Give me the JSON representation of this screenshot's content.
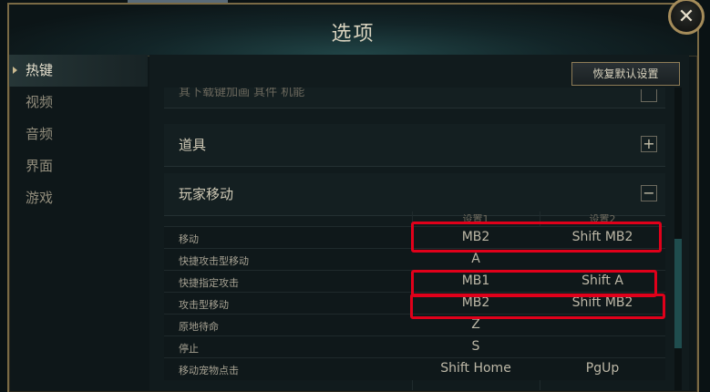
{
  "window": {
    "title": "选项",
    "close_glyph": "✕"
  },
  "sidebar": {
    "items": [
      {
        "label": "热键",
        "active": true
      },
      {
        "label": "视频"
      },
      {
        "label": "音频"
      },
      {
        "label": "界面"
      },
      {
        "label": "游戏"
      }
    ]
  },
  "toolbar": {
    "reset_label": "恢复默认设置"
  },
  "sections": {
    "cut_off_label": "其下载键加画 其件 机能",
    "items": {
      "label": "道具",
      "toggle": "+"
    },
    "movement": {
      "label": "玩家移动",
      "toggle": "−"
    }
  },
  "table": {
    "headers": [
      "设置1",
      "设置2"
    ],
    "rows": [
      {
        "name": "移动",
        "key1": "MB2",
        "key2": "Shift MB2"
      },
      {
        "name": "快捷攻击型移动",
        "key1": "A",
        "key2": ""
      },
      {
        "name": "快捷指定攻击",
        "key1": "MB1",
        "key2": "Shift A"
      },
      {
        "name": "攻击型移动",
        "key1": "MB2",
        "key2": "Shift MB2"
      },
      {
        "name": "原地待命",
        "key1": "Z",
        "key2": ""
      },
      {
        "name": "停止",
        "key1": "S",
        "key2": ""
      },
      {
        "name": "移动宠物点击",
        "key1": "Shift Home",
        "key2": "PgUp"
      }
    ]
  },
  "colors": {
    "highlight": "#e0001a",
    "accent": "#a58c5a"
  }
}
